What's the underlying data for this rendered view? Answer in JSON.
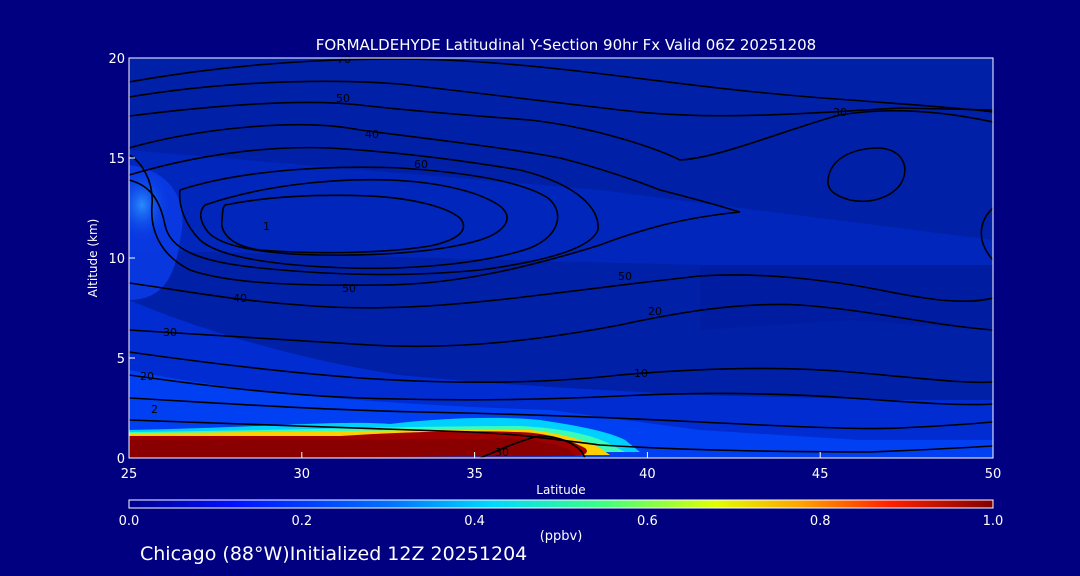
{
  "chart_data": {
    "type": "heatmap",
    "title": "FORMALDEHYDE Latitudinal Y-Section 90hr  Fx Valid 06Z 20251208",
    "xlabel": "Latitude",
    "ylabel": "Altitude (km)",
    "xlim": [
      25,
      50
    ],
    "ylim": [
      0,
      20
    ],
    "x_ticks": [
      "25",
      "30",
      "35",
      "40",
      "45",
      "50"
    ],
    "y_ticks": [
      "0",
      "5",
      "10",
      "15",
      "20"
    ],
    "colorbar": {
      "label": "(ppbv)",
      "range": [
        0.0,
        1.0
      ],
      "ticks": [
        "0.0",
        "0.2",
        "0.4",
        "0.6",
        "0.8",
        "1.0"
      ]
    },
    "contour_labels": [
      "70",
      "50",
      "40",
      "60",
      "1",
      "50",
      "30",
      "40",
      "30",
      "20",
      "2",
      "50",
      "20",
      "10",
      "30"
    ],
    "field_regions": [
      {
        "lat": [
          25,
          38
        ],
        "alt": [
          0.0,
          0.9
        ],
        "value": 1.0
      },
      {
        "lat": [
          36,
          38
        ],
        "alt": [
          0.9,
          1.2
        ],
        "value": 0.95
      },
      {
        "lat": [
          33,
          38
        ],
        "alt": [
          0.9,
          1.3
        ],
        "value": 0.55
      },
      {
        "lat": [
          38,
          40
        ],
        "alt": [
          0.3,
          1.0
        ],
        "value": 0.4
      },
      {
        "lat": [
          25,
          36
        ],
        "alt": [
          0.9,
          1.4
        ],
        "value": 0.35
      },
      {
        "lat": [
          25,
          27
        ],
        "alt": [
          11.5,
          15.5
        ],
        "value": 0.25
      },
      {
        "lat": [
          25,
          40
        ],
        "alt": [
          1.5,
          5.0
        ],
        "value": 0.15
      }
    ],
    "grid": false
  },
  "colors": {
    "background": "#000080",
    "text": "#ffffff",
    "contour": "#000000"
  },
  "footer": "Chicago (88°W)Initialized 12Z 20251204"
}
